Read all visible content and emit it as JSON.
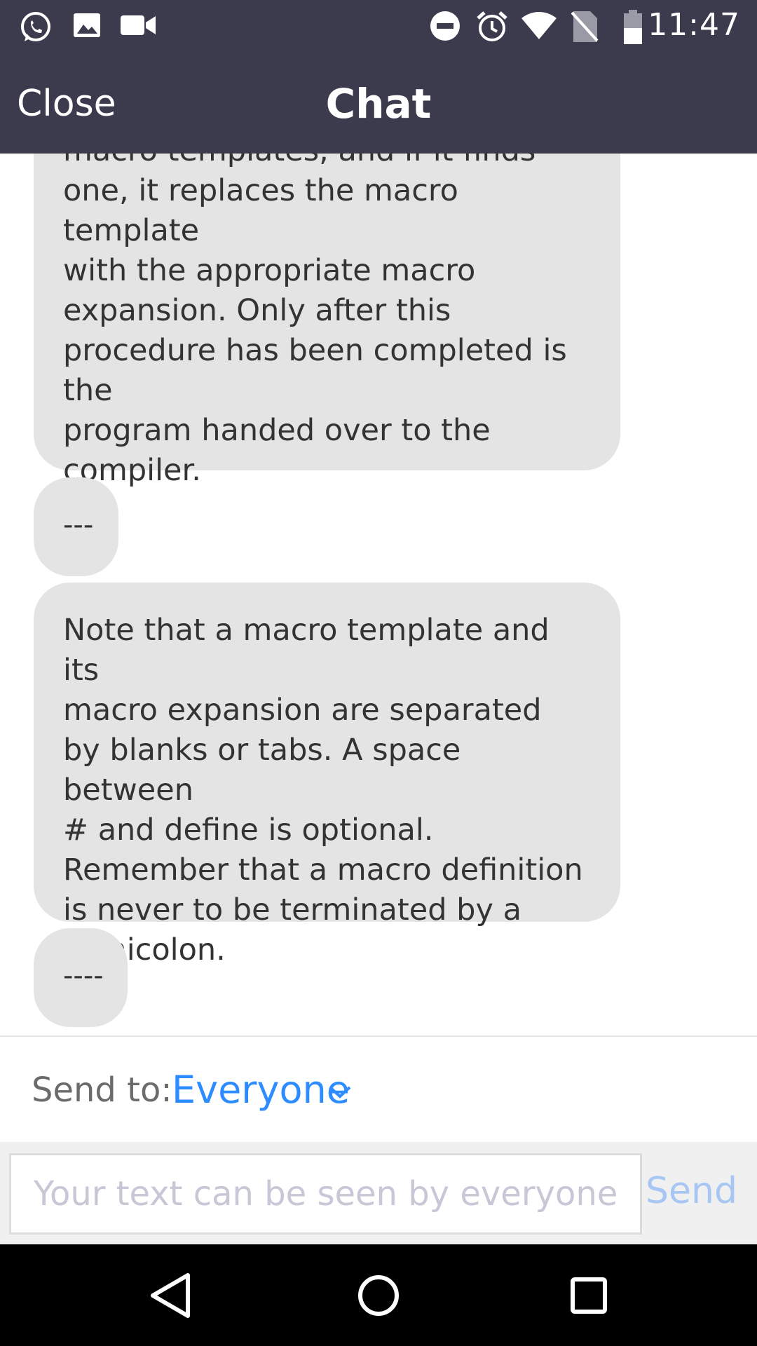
{
  "status_bar": {
    "time": "11:47",
    "left_icons": [
      "whatsapp-icon",
      "image-icon",
      "video-camera-icon"
    ],
    "right_icons": [
      "do-not-disturb-icon",
      "alarm-icon",
      "wifi-icon",
      "no-sim-icon",
      "battery-icon"
    ]
  },
  "header": {
    "close_label": "Close",
    "title": "Chat"
  },
  "messages": [
    {
      "text": "macro templates, and if it finds\none, it replaces the macro template\nwith the appropriate macro\nexpansion. Only after this\nprocedure has been completed is\nthe\nprogram handed over to the\ncompiler."
    },
    {
      "text": "---"
    },
    {
      "text": "Note that a macro template and its\nmacro expansion are separated\nby blanks or tabs. A space between\n# and define is optional.\nRemember that a macro definition\nis never to be terminated by a\nsemicolon."
    },
    {
      "text": "----"
    }
  ],
  "send_to": {
    "label": "Send to:",
    "value": "Everyone"
  },
  "composer": {
    "placeholder": "Your text can be seen by everyone",
    "send_label": "Send"
  },
  "colors": {
    "header_bg": "#3c3b4d",
    "bubble_bg": "#e4e4e4",
    "accent": "#2d8cff",
    "send_disabled": "#a7c6f3"
  }
}
